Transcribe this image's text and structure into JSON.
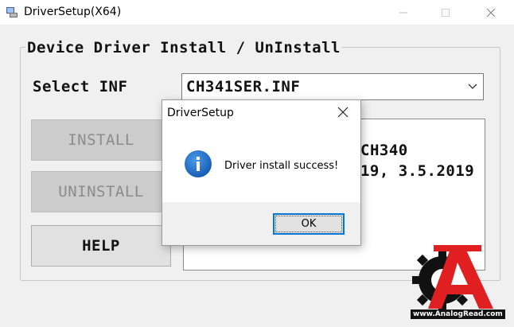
{
  "window": {
    "title": "DriverSetup(X64)",
    "controls": {
      "minimize": "minimize-icon",
      "maximize": "maximize-icon",
      "close": "close-icon"
    }
  },
  "group": {
    "title": "Device Driver Install / UnInstall"
  },
  "inf": {
    "label": "Select INF",
    "selected": "CH341SER.INF"
  },
  "buttons": {
    "install": "INSTALL",
    "uninstall": "UNINSTALL",
    "help": "HELP"
  },
  "info": {
    "line1": "CH340",
    "line2": "019, 3.5.2019"
  },
  "dialog": {
    "title": "DriverSetup",
    "message": "Driver install success!",
    "ok_label": "OK",
    "icon": "info-icon"
  },
  "watermark": {
    "text": "www.AnalogRead.com",
    "logo_letter": "A"
  },
  "colors": {
    "accent": "#0078d7",
    "info_icon": "#1e6ec8",
    "watermark_red": "#e02020",
    "watermark_dark": "#111111"
  }
}
